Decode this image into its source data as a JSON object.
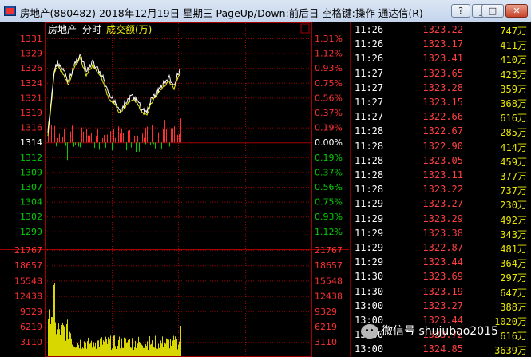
{
  "window": {
    "title": "房地产(880482) 2018年12月19日 星期三 PageUp/Down:前后日 空格键:操作 通达信(R)",
    "buttons": {
      "help": "?",
      "minimize": "_",
      "restore": "□",
      "close": "✕"
    }
  },
  "chart": {
    "name": "房地产",
    "mode": "分时",
    "indicator": "成交额(万)",
    "colors": {
      "up": "#ff3030",
      "down": "#00d000",
      "flat": "#ffffff",
      "price_line": "#ffffff",
      "avg_line": "#f0f000",
      "volume": "#d8d800",
      "grid": "#a00000"
    },
    "price_left_labels": [
      "1331",
      "1329",
      "1326",
      "1324",
      "1321",
      "1319",
      "1316",
      "1314",
      "1312",
      "1309",
      "1307",
      "1304",
      "1302",
      "1299"
    ],
    "percent_right_labels": [
      "1.31%",
      "1.12%",
      "0.93%",
      "0.75%",
      "0.56%",
      "0.37%",
      "0.19%",
      "0.00%",
      "0.19%",
      "0.37%",
      "0.56%",
      "0.75%",
      "0.93%",
      "1.12%"
    ],
    "volume_left_labels": [
      "21767",
      "18657",
      "15548",
      "12438",
      "9329",
      "6219",
      "3110"
    ],
    "volume_right_labels": [
      "21767",
      "18657",
      "15548",
      "12438",
      "9329",
      "6219",
      "3110"
    ]
  },
  "ticks": [
    {
      "time": "11:26",
      "price": "1323.22",
      "vol": "747",
      "unit": "万"
    },
    {
      "time": "11:26",
      "price": "1323.17",
      "vol": "411",
      "unit": "万"
    },
    {
      "time": "11:26",
      "price": "1323.41",
      "vol": "410",
      "unit": "万"
    },
    {
      "time": "11:27",
      "price": "1323.65",
      "vol": "423",
      "unit": "万"
    },
    {
      "time": "11:27",
      "price": "1323.28",
      "vol": "359",
      "unit": "万"
    },
    {
      "time": "11:27",
      "price": "1323.15",
      "vol": "368",
      "unit": "万"
    },
    {
      "time": "11:27",
      "price": "1322.66",
      "vol": "616",
      "unit": "万"
    },
    {
      "time": "11:28",
      "price": "1322.67",
      "vol": "285",
      "unit": "万"
    },
    {
      "time": "11:28",
      "price": "1322.90",
      "vol": "414",
      "unit": "万"
    },
    {
      "time": "11:28",
      "price": "1323.05",
      "vol": "459",
      "unit": "万"
    },
    {
      "time": "11:28",
      "price": "1323.11",
      "vol": "377",
      "unit": "万"
    },
    {
      "time": "11:28",
      "price": "1323.22",
      "vol": "737",
      "unit": "万"
    },
    {
      "time": "11:29",
      "price": "1323.27",
      "vol": "230",
      "unit": "万"
    },
    {
      "time": "11:29",
      "price": "1323.29",
      "vol": "492",
      "unit": "万"
    },
    {
      "time": "11:29",
      "price": "1323.38",
      "vol": "343",
      "unit": "万"
    },
    {
      "time": "11:29",
      "price": "1322.87",
      "vol": "481",
      "unit": "万"
    },
    {
      "time": "11:29",
      "price": "1323.44",
      "vol": "364",
      "unit": "万"
    },
    {
      "time": "11:30",
      "price": "1323.69",
      "vol": "297",
      "unit": "万"
    },
    {
      "time": "11:30",
      "price": "1323.19",
      "vol": "647",
      "unit": "万"
    },
    {
      "time": "13:00",
      "price": "1323.27",
      "vol": "388",
      "unit": "万"
    },
    {
      "time": "13:00",
      "price": "1323.44",
      "vol": "1020",
      "unit": "万"
    },
    {
      "time": "13:00",
      "price": "1323.72",
      "vol": "616",
      "unit": "万"
    },
    {
      "time": "13:00",
      "price": "1324.85",
      "vol": "3639",
      "unit": "万"
    }
  ],
  "watermark": "微信号 shujubao2015"
}
